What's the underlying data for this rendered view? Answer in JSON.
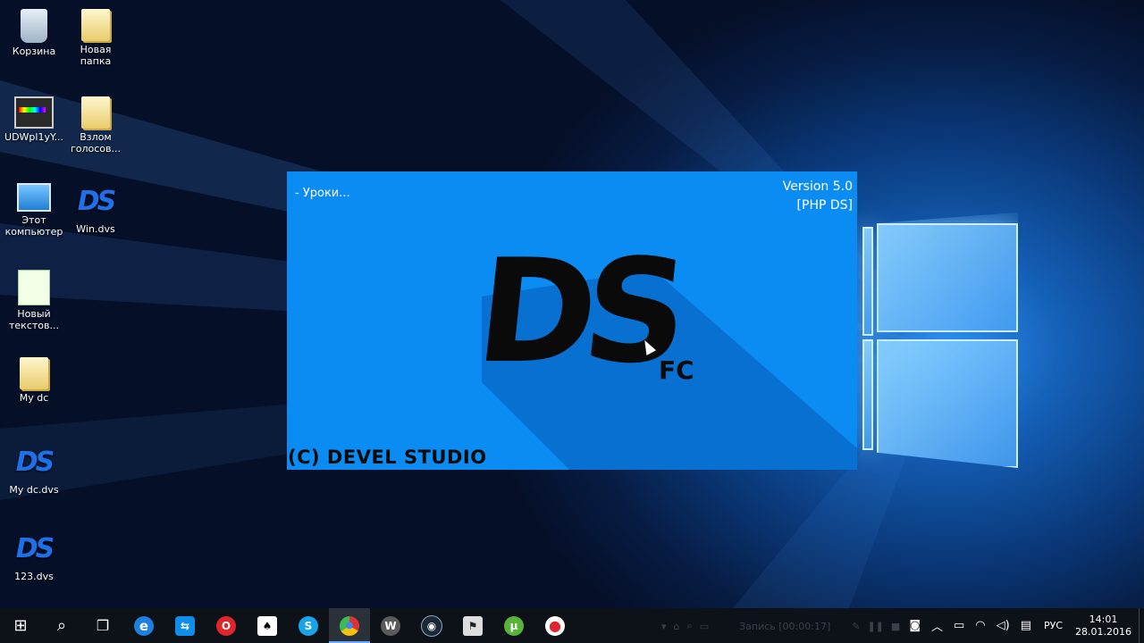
{
  "desktop": {
    "icons": [
      {
        "label": "Корзина",
        "icon": "recycle-bin-icon"
      },
      {
        "label": "Новая папка",
        "icon": "folder-icon"
      },
      {
        "label": "UDWpl1yY...",
        "icon": "video-file-icon"
      },
      {
        "label": "Взлом голосов...",
        "icon": "folder-icon"
      },
      {
        "label": "Этот компьютер",
        "icon": "computer-icon"
      },
      {
        "label": "Win.dvs",
        "icon": "ds-file-icon"
      },
      {
        "label": "Новый текстов...",
        "icon": "text-file-icon"
      },
      {
        "label": "My dc",
        "icon": "folder-icon"
      },
      {
        "label": "My dc.dvs",
        "icon": "ds-file-icon"
      },
      {
        "label": "123.dvs",
        "icon": "ds-file-icon"
      }
    ]
  },
  "splash": {
    "lessons": "- Уроки...",
    "version": "Version 5.0",
    "edition": "[PHP DS]",
    "logo": "DS",
    "logo_sub": "FC",
    "copyright": "(C) DEVEL STUDIO",
    "bg_color": "#0b8cf2"
  },
  "recorder": {
    "label": "Запись [00:00:17]"
  },
  "taskbar": {
    "apps": [
      {
        "name": "start",
        "glyph": "⊞"
      },
      {
        "name": "search",
        "glyph": "⌕"
      },
      {
        "name": "task-view",
        "glyph": "❐"
      },
      {
        "name": "edge",
        "glyph": "e"
      },
      {
        "name": "teamviewer",
        "glyph": "⇆"
      },
      {
        "name": "opera",
        "glyph": "O"
      },
      {
        "name": "solitaire",
        "glyph": "♠"
      },
      {
        "name": "skype",
        "glyph": "S"
      },
      {
        "name": "chrome",
        "glyph": "●"
      },
      {
        "name": "world-of-tanks",
        "glyph": "W"
      },
      {
        "name": "steam",
        "glyph": "◉"
      },
      {
        "name": "counter-strike",
        "glyph": "⚑"
      },
      {
        "name": "utorrent",
        "glyph": "µ"
      },
      {
        "name": "bandicam",
        "glyph": "●"
      }
    ],
    "tray": {
      "language": "РУС",
      "time": "14:01",
      "date": "28.01.2016"
    }
  }
}
